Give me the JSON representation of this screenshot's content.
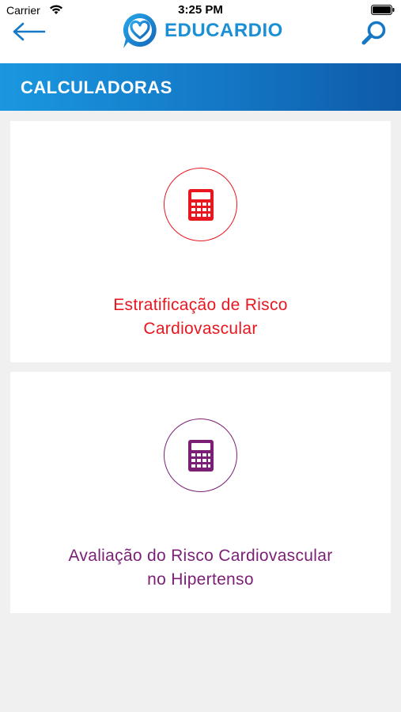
{
  "status": {
    "carrier": "Carrier",
    "time": "3:25 PM"
  },
  "nav": {
    "logo_text": "EDUCARDIO",
    "back_icon": "arrow-left-icon",
    "search_icon": "search-icon"
  },
  "section": {
    "title": "CALCULADORAS"
  },
  "cards": [
    {
      "title_line1": "Estratificação de Risco",
      "title_line2": "Cardiovascular",
      "color": "#e8171f",
      "icon": "calculator-icon"
    },
    {
      "title_line1": "Avaliação do Risco Cardiovascular",
      "title_line2": "no Hipertenso",
      "color": "#7b1f76",
      "icon": "calculator-icon"
    }
  ],
  "colors": {
    "brand_blue": "#1b8fd6",
    "header_gradient_start": "#1a97e0",
    "header_gradient_end": "#0d5aa8",
    "background": "#f0f0f0"
  }
}
